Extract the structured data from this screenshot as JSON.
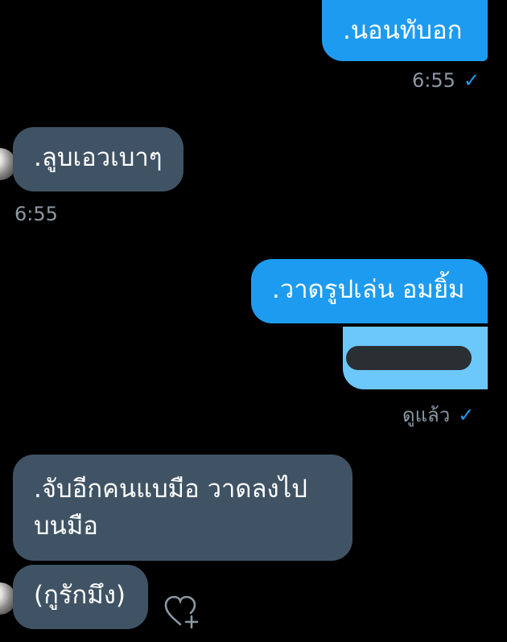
{
  "messages": [
    {
      "id": "m1",
      "side": "sent",
      "text": ".นอนทับอก",
      "time": "6:55"
    },
    {
      "id": "m2",
      "side": "received",
      "text": ".ลูบเอวเบาๆ",
      "time": "6:55"
    },
    {
      "id": "m3",
      "side": "sent",
      "text": ".วาดรูปเล่น อมยิ้ม",
      "status": "ดูแล้ว"
    },
    {
      "id": "m4",
      "side": "received",
      "text_line1": ".จับอีกคนแบมือ วาดลงไป",
      "text_line2": "บนมือ"
    },
    {
      "id": "m5",
      "side": "received",
      "text": "(กูรักมึง)"
    }
  ],
  "colors": {
    "sent_bubble": "#1d9bf0",
    "received_bubble": "#3f5364",
    "quoted_media": "#6cc8fa",
    "read_check": "#1d9bf0",
    "timestamp": "#8b98a5"
  },
  "icons": {
    "read_check": "✓",
    "react_heart": "heart-plus-icon"
  }
}
